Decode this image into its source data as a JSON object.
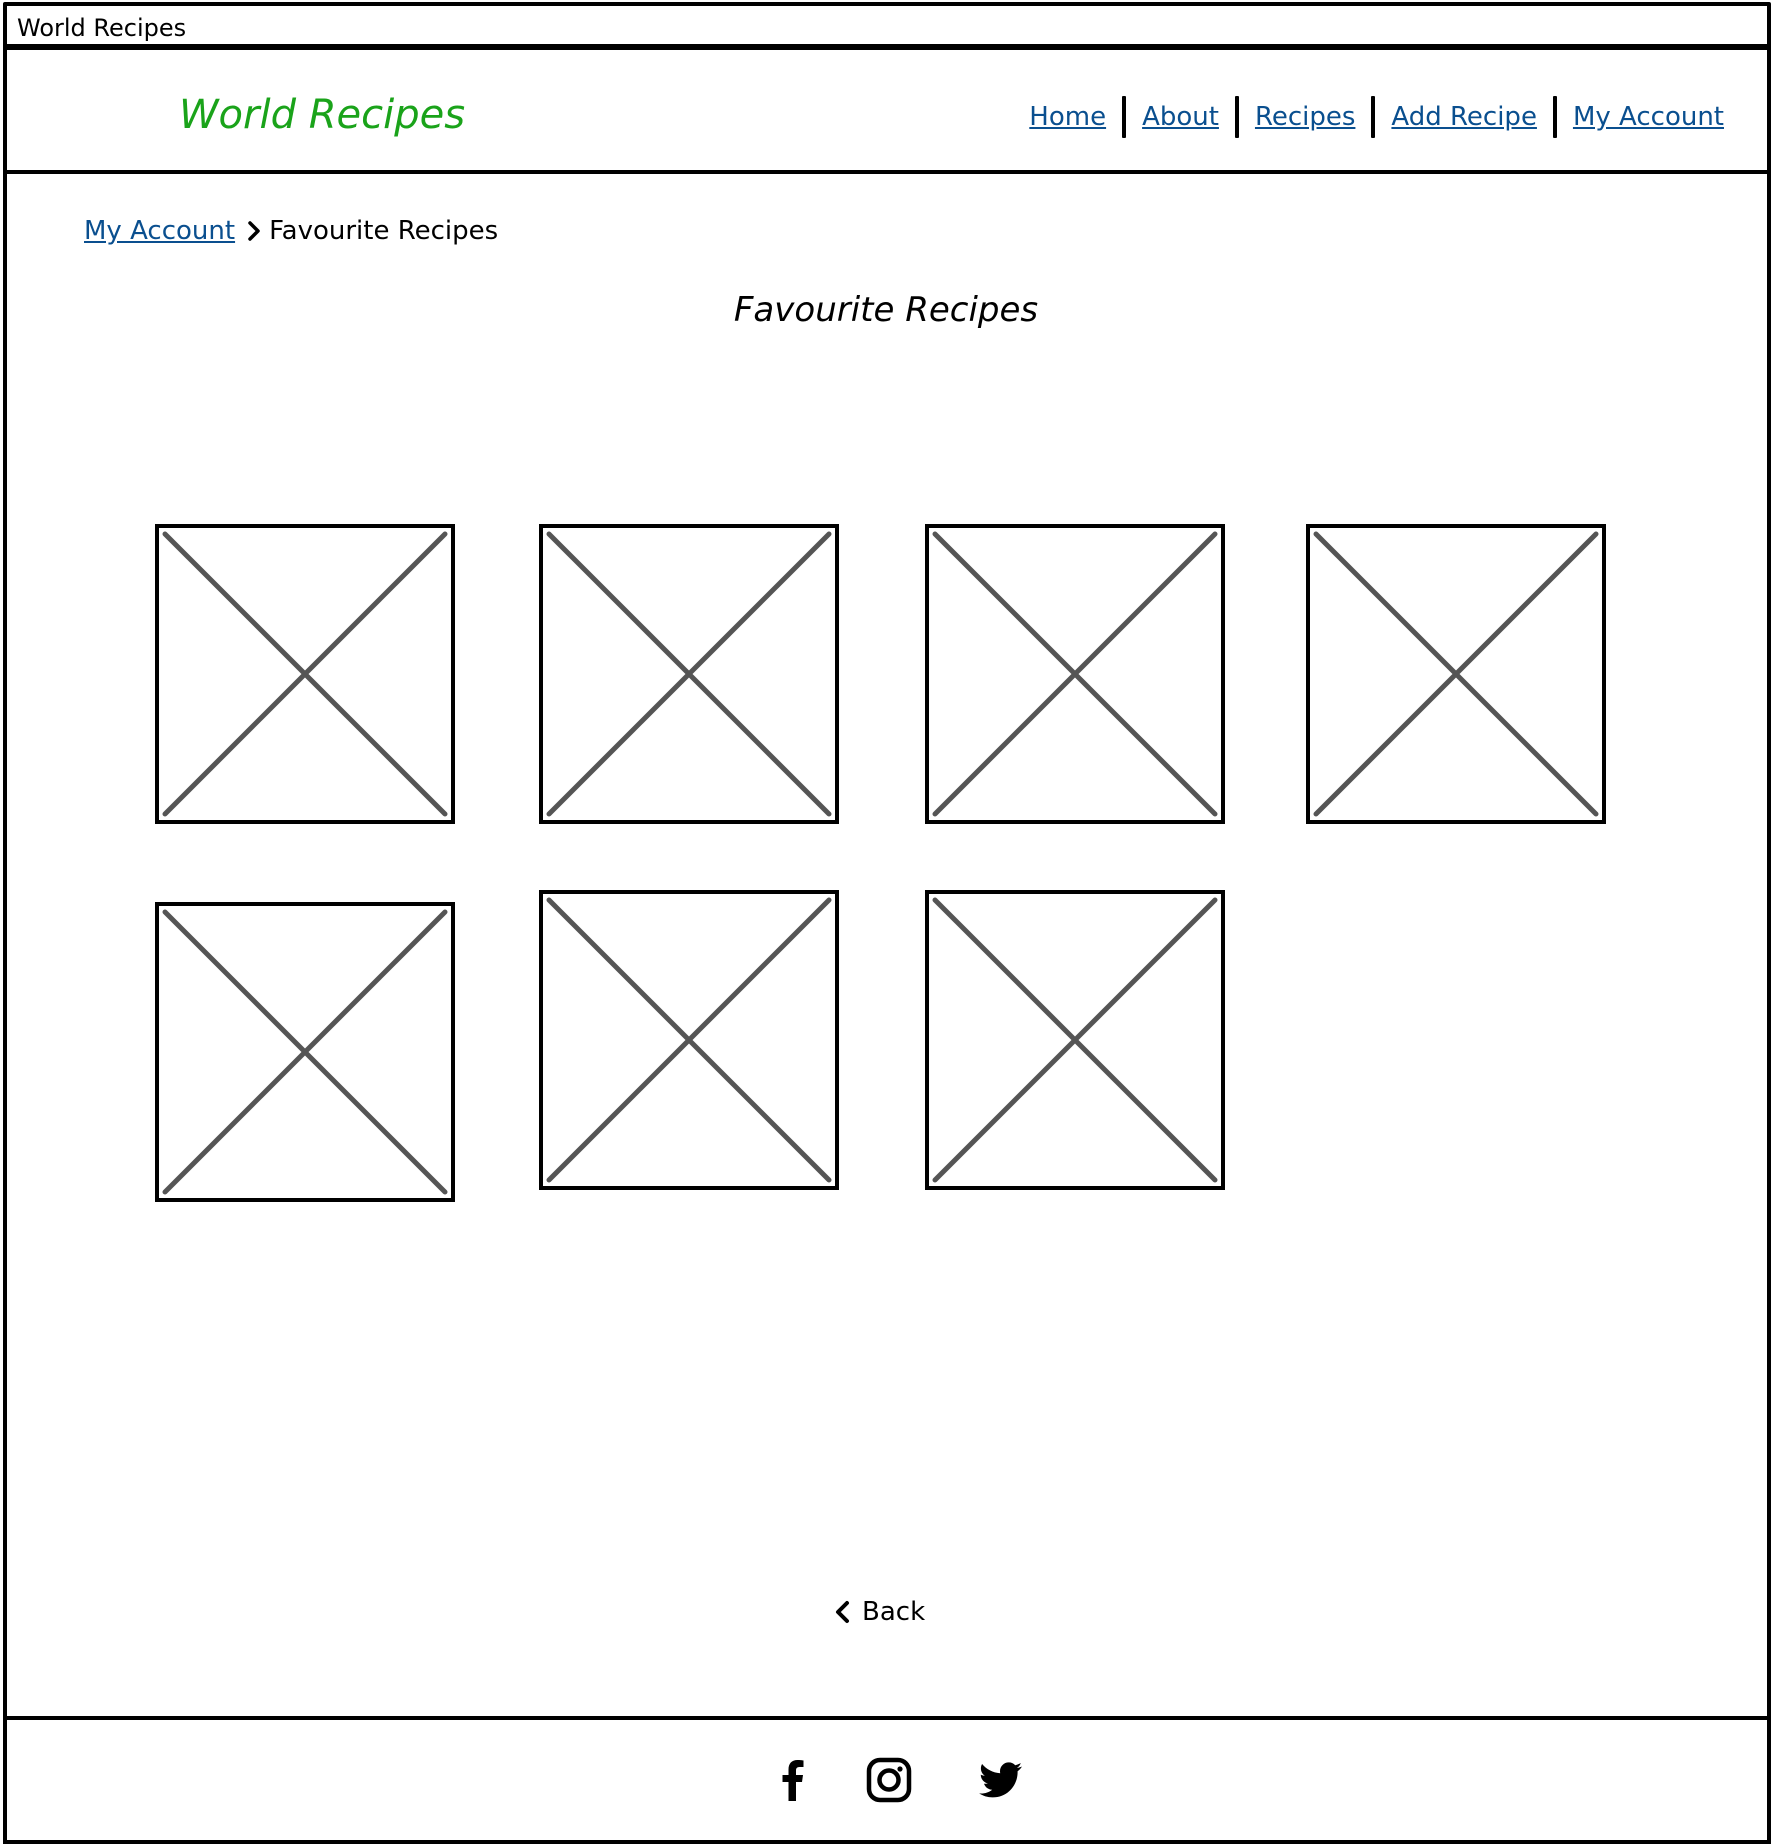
{
  "window": {
    "title": "World Recipes"
  },
  "header": {
    "logo": "World Recipes",
    "nav": [
      "Home",
      "About",
      "Recipes",
      "Add Recipe",
      "My Account"
    ]
  },
  "breadcrumb": {
    "parent": "My Account",
    "current": "Favourite Recipes"
  },
  "main": {
    "title": "Favourite Recipes",
    "tile_count": 7,
    "back_label": "Back"
  },
  "footer": {
    "social": [
      "facebook-icon",
      "instagram-icon",
      "twitter-icon"
    ]
  },
  "colors": {
    "logo": "#1aa31a",
    "link": "#0a4f8f",
    "border": "#000000",
    "placeholder_cross": "#555555"
  }
}
